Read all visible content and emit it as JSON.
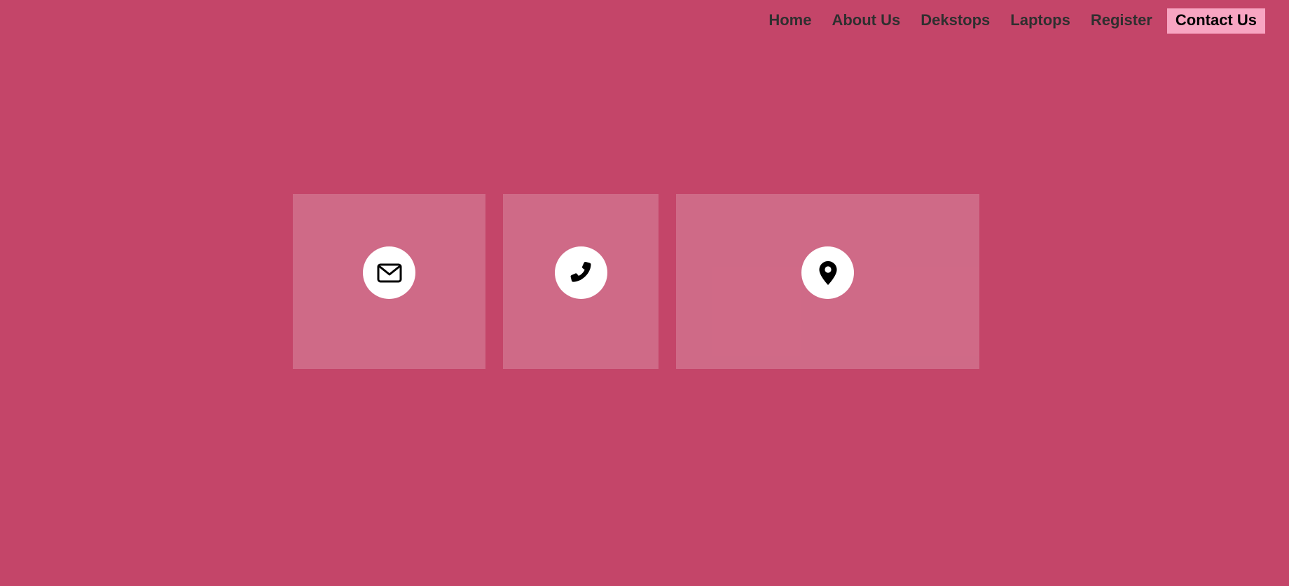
{
  "nav": {
    "items": [
      {
        "label": "Home",
        "active": false
      },
      {
        "label": "About Us",
        "active": false
      },
      {
        "label": "Dekstops",
        "active": false
      },
      {
        "label": "Laptops",
        "active": false
      },
      {
        "label": "Register",
        "active": false
      },
      {
        "label": "Contact Us",
        "active": true
      }
    ]
  },
  "contact_cards": [
    {
      "icon": "envelope-icon"
    },
    {
      "icon": "phone-icon"
    },
    {
      "icon": "map-pin-icon"
    }
  ],
  "colors": {
    "background": "#c44569",
    "active_nav_bg": "#f8a5c2",
    "nav_text": "#2f2f2f",
    "icon_circle": "#ffffff"
  }
}
